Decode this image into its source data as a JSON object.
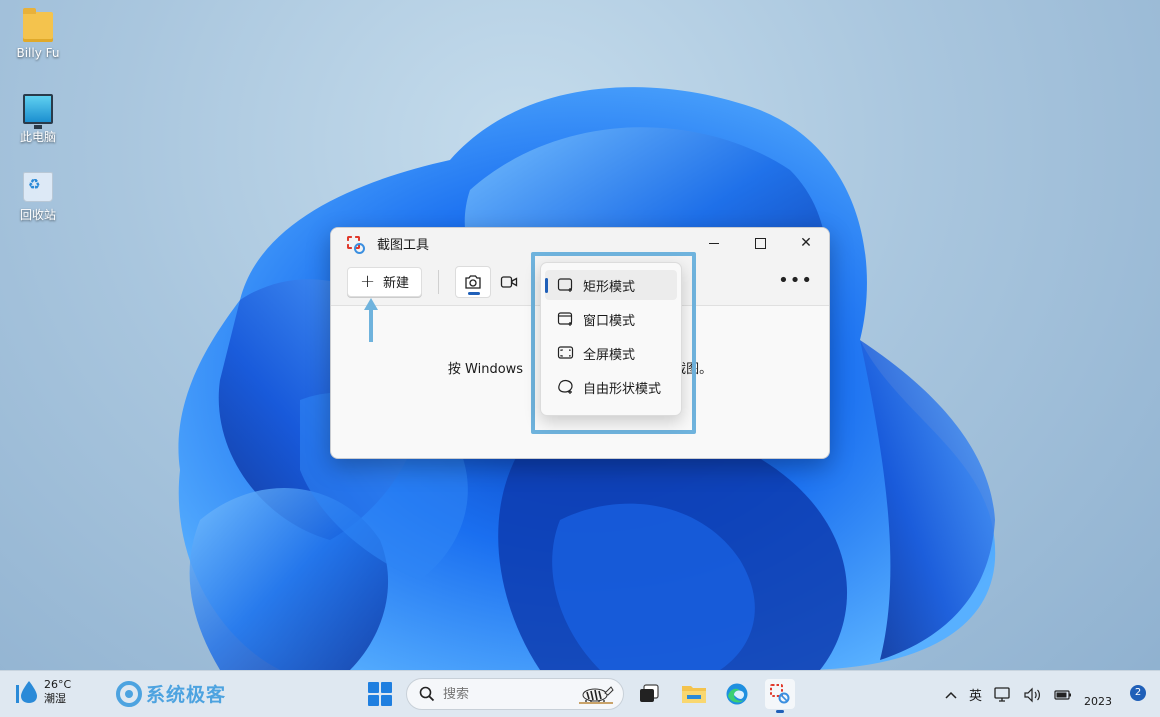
{
  "desktop": {
    "icons": [
      {
        "label": "Billy Fu",
        "icon": "folder-icon"
      },
      {
        "label": "此电脑",
        "icon": "computer-icon"
      },
      {
        "label": "回收站",
        "icon": "recycle-bin-icon"
      }
    ]
  },
  "snip_window": {
    "title": "截图工具",
    "toolbar": {
      "new_label": "新建",
      "new_icon": "plus-icon",
      "modes": [
        {
          "name": "screenshot-mode",
          "icon": "camera-icon",
          "active": true
        },
        {
          "name": "record-mode",
          "icon": "video-icon",
          "active": false
        }
      ],
      "more_label": "•••"
    },
    "hint_start": "按 Windows",
    "hint_end": "截图。"
  },
  "dropdown": {
    "items": [
      {
        "label": "矩形模式",
        "icon": "rectangle-snip-icon",
        "selected": true
      },
      {
        "label": "窗口模式",
        "icon": "window-snip-icon",
        "selected": false
      },
      {
        "label": "全屏模式",
        "icon": "fullscreen-snip-icon",
        "selected": false
      },
      {
        "label": "自由形状模式",
        "icon": "freeform-snip-icon",
        "selected": false
      }
    ]
  },
  "taskbar": {
    "weather": {
      "temperature": "26°C",
      "condition": "潮湿"
    },
    "brand": "系统极客",
    "search_placeholder": "搜索",
    "tray": {
      "language": "英",
      "clock": "2023",
      "notification_count": "2"
    }
  },
  "colors": {
    "accent": "#1f5fb8",
    "highlight_outline": "#6fb3dd",
    "brand": "#4da3e0"
  }
}
